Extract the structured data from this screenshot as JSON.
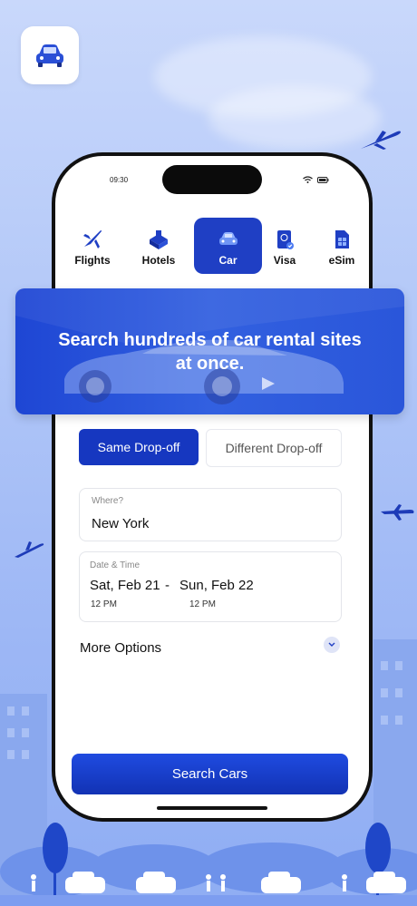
{
  "status_bar": {
    "time": "09:30"
  },
  "tabs": [
    {
      "label": "Flights",
      "icon": "plane-icon"
    },
    {
      "label": "Hotels",
      "icon": "hotel-icon"
    },
    {
      "label": "Car",
      "icon": "car-icon"
    },
    {
      "label": "Visa",
      "icon": "passport-icon"
    },
    {
      "label": "eSim",
      "icon": "sim-card-icon"
    }
  ],
  "active_tab": "Car",
  "banner": {
    "text": "Search hundreds of car rental sites at once."
  },
  "dropoff": {
    "same_label": "Same Drop-off",
    "different_label": "Different Drop-off",
    "selected": "Same Drop-off"
  },
  "where": {
    "label": "Where?",
    "value": "New York"
  },
  "dates": {
    "label": "Date  & Time",
    "start_date": "Sat, Feb 21",
    "separator": "-",
    "end_date": "Sun, Feb 22",
    "start_time": "12 PM",
    "end_time": "12 PM"
  },
  "more_options": {
    "label": "More Options"
  },
  "search_button": {
    "label": "Search Cars"
  },
  "colors": {
    "primary": "#1637c0",
    "background": "#b3c8f8"
  }
}
